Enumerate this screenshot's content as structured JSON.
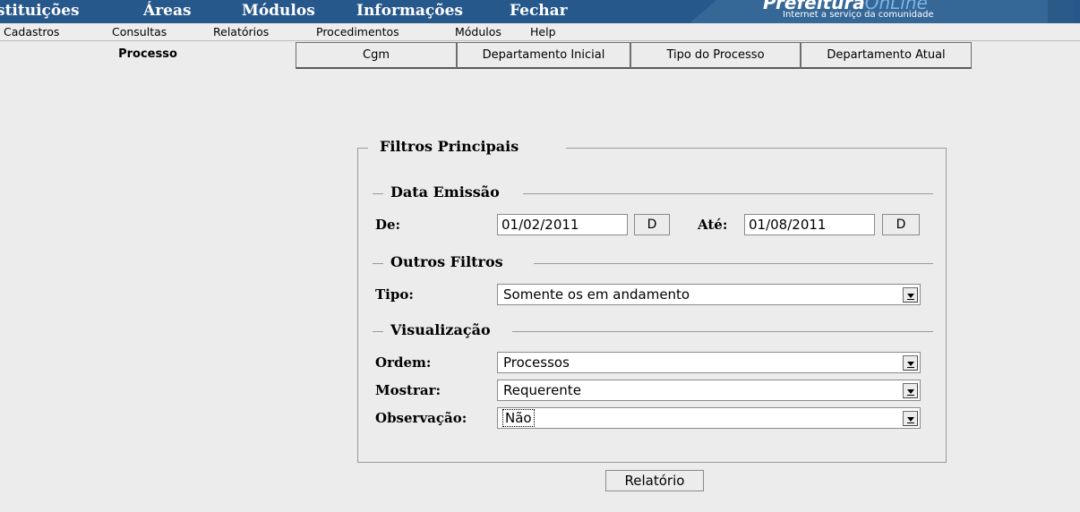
{
  "header": {
    "menu": [
      "stituições",
      "Áreas",
      "Módulos",
      "Informações",
      "Fechar"
    ],
    "logo_title_bold": "Prefeitura",
    "logo_title_light": "OnLine",
    "logo_subtitle": "Internet a serviço da comunidade",
    "colors": {
      "banner": "#27588c",
      "logo_panel": "#356797"
    }
  },
  "menubar": [
    "Cadastros",
    "Consultas",
    "Relatórios",
    "Procedimentos",
    "Módulos",
    "Help"
  ],
  "tabs": {
    "active": "Processo",
    "items": [
      "Cgm",
      "Departamento Inicial",
      "Tipo do Processo",
      "Departamento Atual"
    ]
  },
  "filters": {
    "legend": "Filtros Principais",
    "data_emissao": {
      "legend": "Data Emissão",
      "from_label": "De:",
      "from_value": "01/02/2011",
      "from_button": "D",
      "to_label": "Até:",
      "to_value": "01/08/2011",
      "to_button": "D"
    },
    "outros": {
      "legend": "Outros Filtros",
      "tipo_label": "Tipo:",
      "tipo_value": "Somente os em andamento"
    },
    "visualizacao": {
      "legend": "Visualização",
      "ordem_label": "Ordem:",
      "ordem_value": "Processos",
      "mostrar_label": "Mostrar:",
      "mostrar_value": "Requerente",
      "observacao_label": "Observação:",
      "observacao_value": "Não"
    }
  },
  "report_button": "Relatório",
  "icons": {
    "dropdown_arrow": "chevron-down-icon"
  }
}
